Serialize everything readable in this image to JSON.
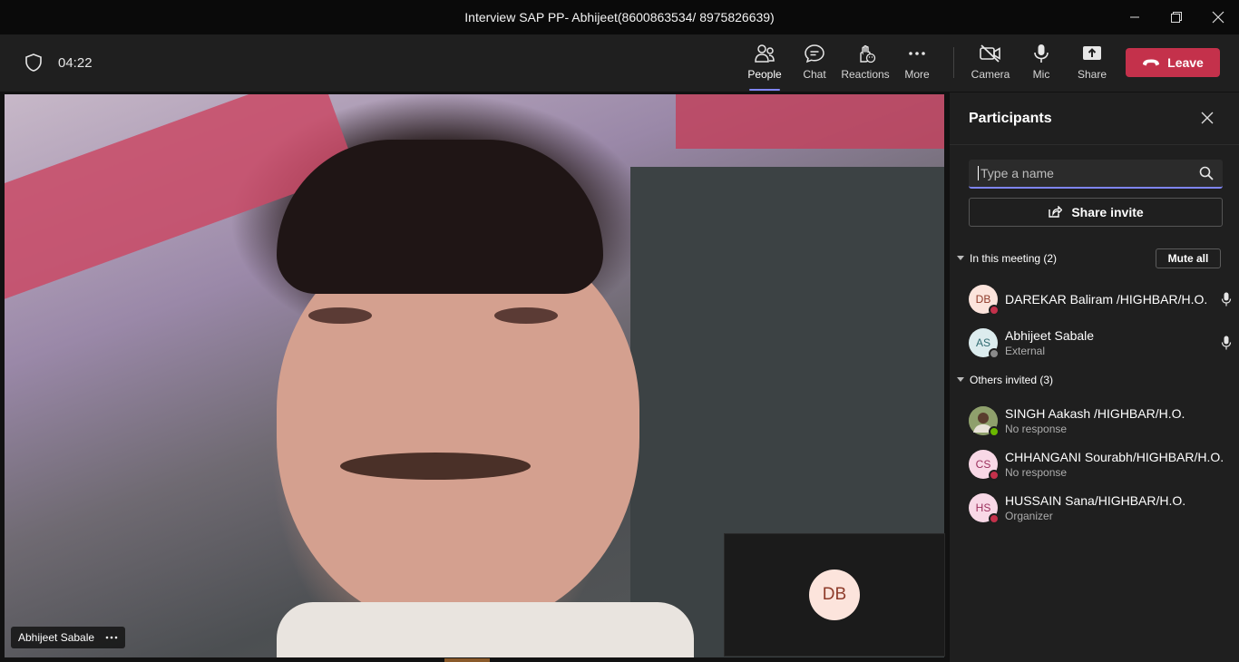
{
  "window": {
    "title": "Interview SAP PP- Abhijeet(8600863534/ 8975826639)"
  },
  "toolbar": {
    "timer": "04:22",
    "buttons": [
      {
        "label": "People",
        "icon": "people-icon",
        "active": true
      },
      {
        "label": "Chat",
        "icon": "chat-icon"
      },
      {
        "label": "Reactions",
        "icon": "reactions-icon"
      },
      {
        "label": "More",
        "icon": "more-icon"
      },
      {
        "label": "Camera",
        "icon": "camera-off-icon"
      },
      {
        "label": "Mic",
        "icon": "mic-icon"
      },
      {
        "label": "Share",
        "icon": "share-icon"
      }
    ],
    "leave_label": "Leave",
    "leave_color": "#c4314b",
    "accent_color": "#7f85f5"
  },
  "stage": {
    "speaker_name": "Abhijeet Sabale",
    "self_initials": "DB"
  },
  "panel": {
    "title": "Participants",
    "search_placeholder": "Type a name",
    "invite_label": "Share invite",
    "in_meeting_label": "In this meeting (2)",
    "mute_all_label": "Mute all",
    "others_label": "Others invited (3)",
    "in_meeting": [
      {
        "initials": "DB",
        "name": "DAREKAR Baliram /HIGHBAR/H.O.",
        "sub": "",
        "status": "busy"
      },
      {
        "initials": "AS",
        "name": "Abhijeet Sabale",
        "sub": "External",
        "status": "offline"
      }
    ],
    "others": [
      {
        "initials": "",
        "name": "SINGH Aakash /HIGHBAR/H.O.",
        "sub": "No response",
        "status": "available"
      },
      {
        "initials": "CS",
        "name": "CHHANGANI Sourabh/HIGHBAR/H.O.",
        "sub": "No response",
        "status": "busy"
      },
      {
        "initials": "HS",
        "name": "HUSSAIN Sana/HIGHBAR/H.O.",
        "sub": "Organizer",
        "status": "busy"
      }
    ]
  }
}
